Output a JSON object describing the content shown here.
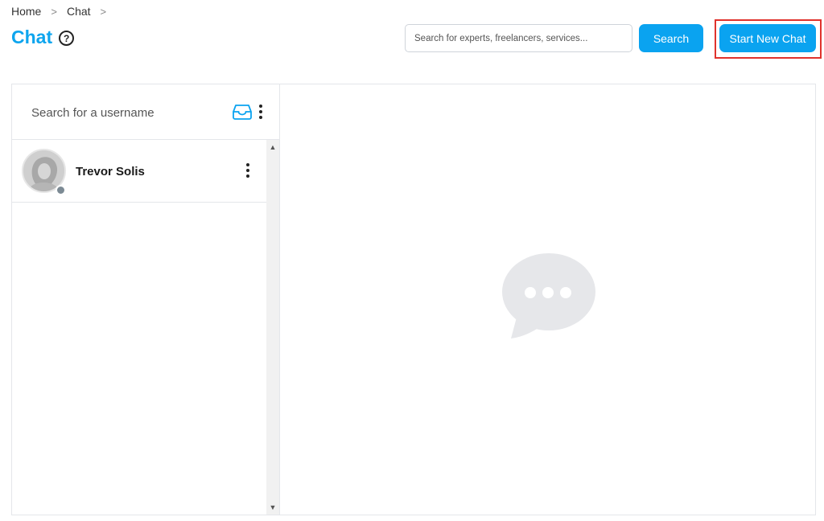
{
  "breadcrumb": {
    "items": [
      "Home",
      "Chat"
    ],
    "separator": ">"
  },
  "page": {
    "title": "Chat",
    "help_icon": "question-circle-icon",
    "title_color": "#0ea5ee"
  },
  "top_search": {
    "placeholder": "Search for experts, freelancers, services...",
    "button_label": "Search"
  },
  "new_chat": {
    "label": "Start New Chat",
    "highlight_color": "#e0322c"
  },
  "sidebar": {
    "search_placeholder": "Search for a username",
    "inbox_icon": "inbox-icon",
    "menu_icon": "kebab-menu-icon",
    "contacts": [
      {
        "name": "Trevor Solis",
        "status": "offline",
        "avatar": "avatar-placeholder"
      }
    ]
  },
  "main": {
    "empty_state_icon": "chat-bubble-dots-icon"
  },
  "colors": {
    "accent": "#0aa3f0",
    "border": "#e4e6ea",
    "empty_icon": "#e5e7eb"
  }
}
